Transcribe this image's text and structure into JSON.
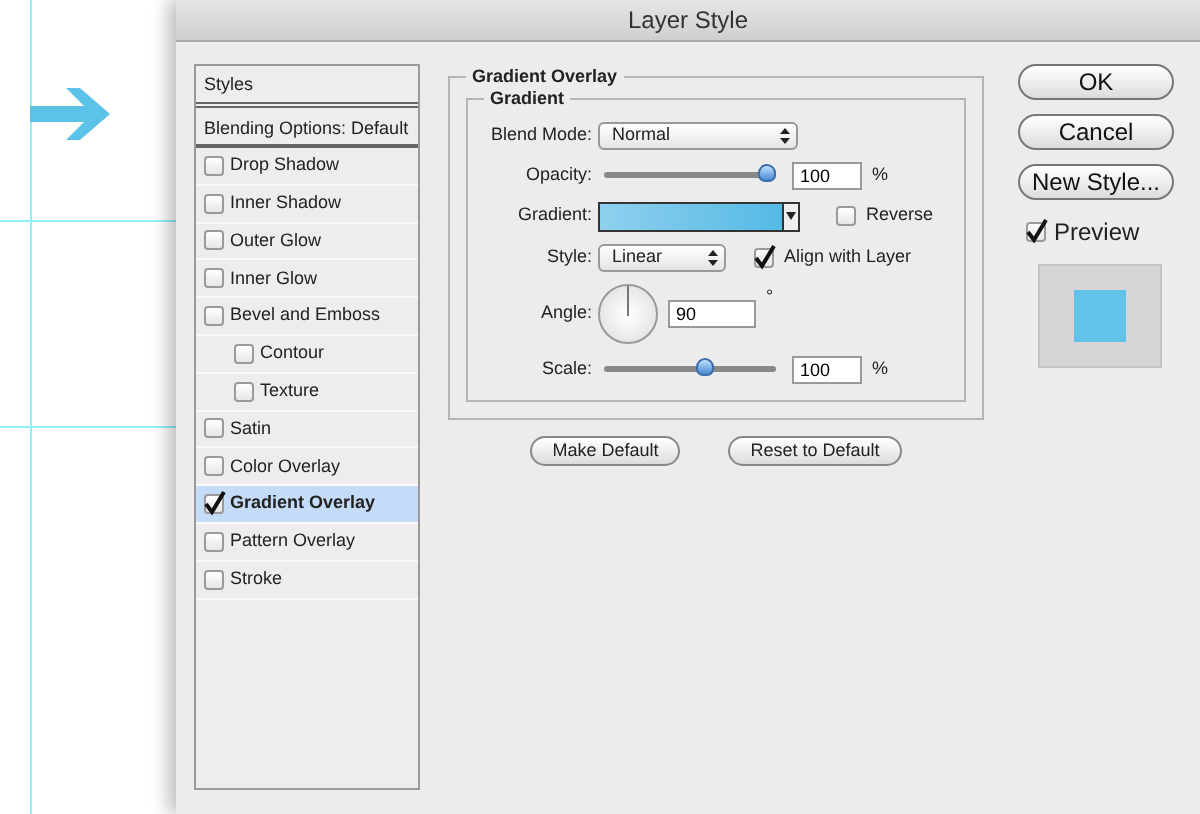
{
  "window": {
    "title": "Layer Style"
  },
  "sidebar": {
    "header": "Styles",
    "blending_options": "Blending Options: Default",
    "items": [
      {
        "label": "Drop Shadow",
        "checked": false,
        "selected": false
      },
      {
        "label": "Inner Shadow",
        "checked": false,
        "selected": false
      },
      {
        "label": "Outer Glow",
        "checked": false,
        "selected": false
      },
      {
        "label": "Inner Glow",
        "checked": false,
        "selected": false
      },
      {
        "label": "Bevel and Emboss",
        "checked": false,
        "selected": false,
        "children": [
          {
            "label": "Contour",
            "checked": false,
            "selected": false
          },
          {
            "label": "Texture",
            "checked": false,
            "selected": false
          }
        ]
      },
      {
        "label": "Satin",
        "checked": false,
        "selected": false
      },
      {
        "label": "Color Overlay",
        "checked": false,
        "selected": false
      },
      {
        "label": "Gradient Overlay",
        "checked": true,
        "selected": true
      },
      {
        "label": "Pattern Overlay",
        "checked": false,
        "selected": false
      },
      {
        "label": "Stroke",
        "checked": false,
        "selected": false
      }
    ]
  },
  "panel": {
    "title": "Gradient Overlay",
    "group_title": "Gradient",
    "blend_mode": {
      "label": "Blend Mode:",
      "value": "Normal"
    },
    "opacity": {
      "label": "Opacity:",
      "level": 1,
      "value": "100",
      "unit": "%"
    },
    "gradient": {
      "label": "Gradient:"
    },
    "reverse": {
      "label": "Reverse",
      "checked": false
    },
    "style": {
      "label": "Style:",
      "value": "Linear"
    },
    "align_with_layer": {
      "label": "Align with Layer",
      "checked": true
    },
    "angle": {
      "label": "Angle:",
      "value": "90",
      "unit": "°"
    },
    "scale": {
      "label": "Scale:",
      "level": 0.6,
      "value": "100",
      "unit": "%"
    },
    "buttons": [
      "Make Default",
      "Reset to Default"
    ]
  },
  "actions": [
    "OK",
    "Cancel",
    "New Style..."
  ],
  "preview": {
    "label": "Preview",
    "checked": true
  }
}
